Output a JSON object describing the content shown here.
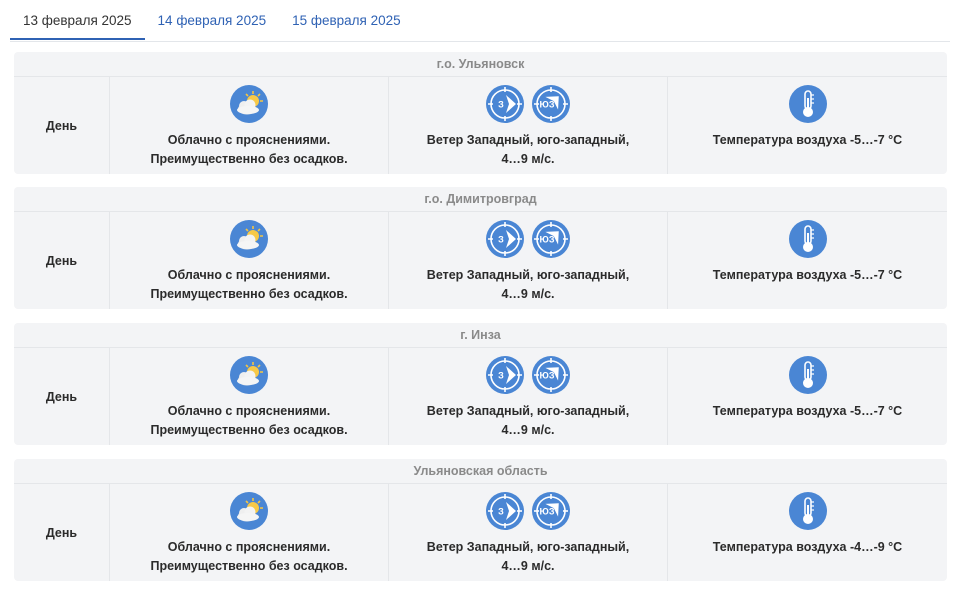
{
  "tabs": [
    {
      "label": "13 февраля 2025",
      "active": true
    },
    {
      "label": "14 февраля 2025",
      "active": false
    },
    {
      "label": "15 февраля 2025",
      "active": false
    }
  ],
  "colors": {
    "accent": "#2f62b4",
    "icon_blue": "#4a86d4",
    "card_bg": "#f3f4f6"
  },
  "forecasts": [
    {
      "location": "г.о. Ульяновск",
      "period": "День",
      "weather": {
        "icon": "partly-cloudy-icon",
        "line1": "Облачно с прояснениями.",
        "line2": "Преимущественно без осадков."
      },
      "wind": {
        "icons": [
          "wind-west-icon",
          "wind-southwest-icon"
        ],
        "dir1": "З",
        "dir2": "ЮЗ",
        "line1": "Ветер Западный, юго-западный,",
        "line2": "4…9 м/с."
      },
      "temp": {
        "icon": "thermometer-icon",
        "line1": "Температура воздуха -5…-7 °С"
      }
    },
    {
      "location": "г.о. Димитровград",
      "period": "День",
      "weather": {
        "icon": "partly-cloudy-icon",
        "line1": "Облачно с прояснениями.",
        "line2": "Преимущественно без осадков."
      },
      "wind": {
        "icons": [
          "wind-west-icon",
          "wind-southwest-icon"
        ],
        "dir1": "З",
        "dir2": "ЮЗ",
        "line1": "Ветер Западный, юго-западный,",
        "line2": "4…9 м/с."
      },
      "temp": {
        "icon": "thermometer-icon",
        "line1": "Температура воздуха -5…-7 °С"
      }
    },
    {
      "location": "г. Инза",
      "period": "День",
      "weather": {
        "icon": "partly-cloudy-icon",
        "line1": "Облачно с прояснениями.",
        "line2": "Преимущественно без осадков."
      },
      "wind": {
        "icons": [
          "wind-west-icon",
          "wind-southwest-icon"
        ],
        "dir1": "З",
        "dir2": "ЮЗ",
        "line1": "Ветер Западный, юго-западный,",
        "line2": "4…9 м/с."
      },
      "temp": {
        "icon": "thermometer-icon",
        "line1": "Температура воздуха -5…-7 °С"
      }
    },
    {
      "location": "Ульяновская область",
      "period": "День",
      "weather": {
        "icon": "partly-cloudy-icon",
        "line1": "Облачно с прояснениями.",
        "line2": "Преимущественно без осадков."
      },
      "wind": {
        "icons": [
          "wind-west-icon",
          "wind-southwest-icon"
        ],
        "dir1": "З",
        "dir2": "ЮЗ",
        "line1": "Ветер Западный, юго-западный,",
        "line2": "4…9 м/с."
      },
      "temp": {
        "icon": "thermometer-icon",
        "line1": "Температура воздуха -4…-9 °С"
      }
    }
  ]
}
